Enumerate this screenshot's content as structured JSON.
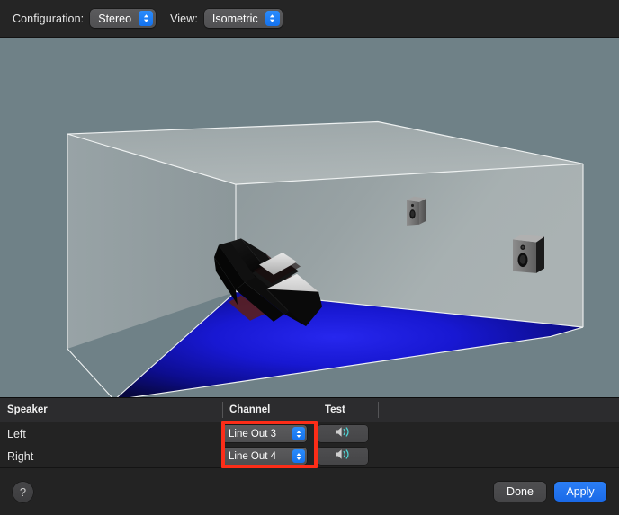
{
  "toolbar": {
    "configuration_label": "Configuration:",
    "configuration_value": "Stereo",
    "view_label": "View:",
    "view_value": "Isometric"
  },
  "scene": {
    "description": "Isometric 3D room with blue floor, gray walls, a black sofa and two speakers",
    "background_color": "#6f8187",
    "wall_color": "#9aa4a6",
    "floor_color": "#1414c8",
    "edge_color": "#f2f2f2",
    "objects": [
      {
        "name": "sofa",
        "label": "Listener sofa"
      },
      {
        "name": "speaker-left",
        "label": "Left speaker"
      },
      {
        "name": "speaker-right",
        "label": "Right speaker"
      }
    ]
  },
  "table": {
    "columns": [
      "Speaker",
      "Channel",
      "Test"
    ],
    "rows": [
      {
        "speaker": "Left",
        "channel": "Line Out 3",
        "test_icon": "speaker-wave-icon"
      },
      {
        "speaker": "Right",
        "channel": "Line Out 4",
        "test_icon": "speaker-wave-icon"
      }
    ]
  },
  "annotation": {
    "color": "#fc2d18",
    "target": "channel-popup-buttons"
  },
  "footer": {
    "help_label": "?",
    "done_label": "Done",
    "apply_label": "Apply"
  },
  "colors": {
    "accent_blue": "#2b7ef5",
    "annotation_red": "#fc2d18",
    "window_bg": "#232323",
    "scene_bg": "#6f8187"
  }
}
